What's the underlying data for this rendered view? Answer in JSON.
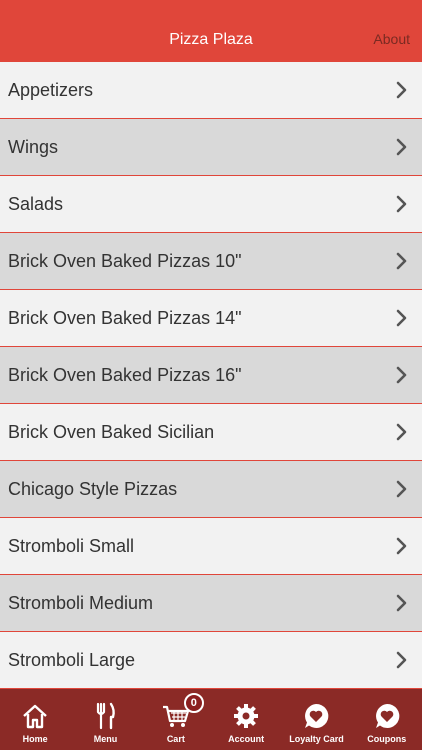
{
  "header": {
    "title": "Pizza Plaza",
    "about_label": "About"
  },
  "menu": {
    "items": [
      {
        "label": "Appetizers"
      },
      {
        "label": "Wings"
      },
      {
        "label": "Salads"
      },
      {
        "label": "Brick Oven Baked Pizzas 10\""
      },
      {
        "label": "Brick Oven Baked Pizzas 14\""
      },
      {
        "label": "Brick Oven Baked Pizzas 16\""
      },
      {
        "label": "Brick Oven Baked Sicilian"
      },
      {
        "label": "Chicago Style Pizzas"
      },
      {
        "label": "Stromboli Small"
      },
      {
        "label": "Stromboli Medium"
      },
      {
        "label": "Stromboli Large"
      }
    ]
  },
  "tabbar": {
    "home": "Home",
    "menu": "Menu",
    "cart": "Cart",
    "cart_count": "0",
    "account": "Account",
    "loyalty": "Loyalty Card",
    "coupons": "Coupons"
  },
  "colors": {
    "accent": "#e0463a",
    "tabbar": "#8b2a26"
  }
}
